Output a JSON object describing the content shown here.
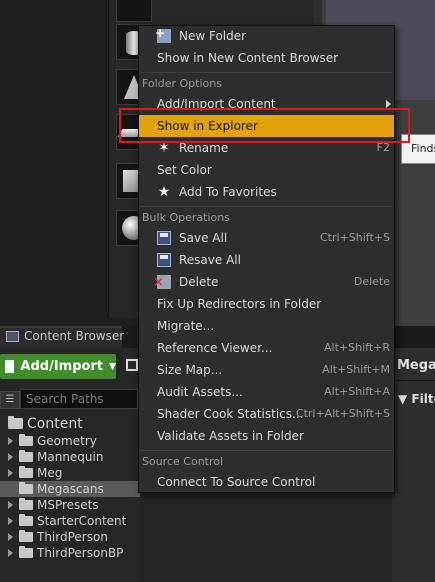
{
  "context_menu": {
    "items_top": [
      {
        "label": "New Folder",
        "icon": "new-folder-icon"
      },
      {
        "label": "Show in New Content Browser"
      }
    ],
    "folder_options": {
      "header": "Folder Options",
      "items": [
        {
          "label": "Add/Import Content",
          "submenu": true
        },
        {
          "label": "Show in Explorer",
          "highlighted": true
        },
        {
          "label": "Rename",
          "icon": "rename-icon",
          "shortcut": "F2"
        },
        {
          "label": "Set Color"
        },
        {
          "label": "Add To Favorites",
          "icon": "star-icon"
        }
      ]
    },
    "bulk_operations": {
      "header": "Bulk Operations",
      "items": [
        {
          "label": "Save All",
          "icon": "save-icon",
          "shortcut": "Ctrl+Shift+S"
        },
        {
          "label": "Resave All",
          "icon": "save-icon"
        },
        {
          "label": "Delete",
          "icon": "delete-icon",
          "shortcut": "Delete"
        },
        {
          "label": "Fix Up Redirectors in Folder"
        },
        {
          "label": "Migrate..."
        },
        {
          "label": "Reference Viewer...",
          "shortcut": "Alt+Shift+R"
        },
        {
          "label": "Size Map...",
          "shortcut": "Alt+Shift+M"
        },
        {
          "label": "Audit Assets...",
          "shortcut": "Alt+Shift+A"
        },
        {
          "label": "Shader Cook Statistics...",
          "shortcut": "Ctrl+Alt+Shift+S"
        },
        {
          "label": "Validate Assets in Folder"
        }
      ]
    },
    "source_control": {
      "header": "Source Control",
      "items": [
        {
          "label": "Connect To Source Control"
        }
      ]
    }
  },
  "tooltip": {
    "text": "Finds"
  },
  "content_browser": {
    "tab_title": "Content Browser",
    "add_import_label": "Add/Import",
    "search_placeholder": "Search Paths",
    "right_panel_title": "Megascans",
    "filters_label": "Filters",
    "tree": {
      "root": "Content",
      "folders": [
        {
          "label": "Geometry",
          "expandable": true
        },
        {
          "label": "Mannequin",
          "expandable": true
        },
        {
          "label": "Meg",
          "expandable": true
        },
        {
          "label": "Megascans",
          "expandable": false,
          "selected": true
        },
        {
          "label": "MSPresets",
          "expandable": true
        },
        {
          "label": "StarterContent",
          "expandable": true
        },
        {
          "label": "ThirdPerson",
          "expandable": true
        },
        {
          "label": "ThirdPersonBP",
          "expandable": true
        }
      ]
    }
  },
  "colors": {
    "menu_highlight": "#e5a20c",
    "annotation_box": "#e01818",
    "add_import_button": "#3f8e2a"
  }
}
